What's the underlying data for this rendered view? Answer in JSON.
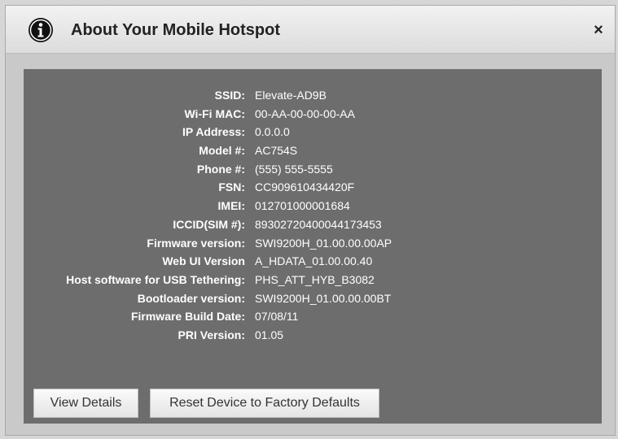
{
  "dialog": {
    "title": "About Your Mobile Hotspot",
    "close_label": "×"
  },
  "info_rows": [
    {
      "label": "SSID:",
      "value": "Elevate-AD9B"
    },
    {
      "label": "Wi-Fi MAC:",
      "value": "00-AA-00-00-00-AA"
    },
    {
      "label": "IP Address:",
      "value": "0.0.0.0"
    },
    {
      "label": "Model #:",
      "value": "AC754S"
    },
    {
      "label": "Phone #:",
      "value": "(555) 555-5555"
    },
    {
      "label": "FSN:",
      "value": "CC909610434420F"
    },
    {
      "label": "IMEI:",
      "value": "012701000001684"
    },
    {
      "label": "ICCID(SIM #):",
      "value": "89302720400044173453"
    },
    {
      "label": "Firmware version:",
      "value": "SWI9200H_01.00.00.00AP"
    },
    {
      "label": "Web UI Version",
      "value": "A_HDATA_01.00.00.40"
    },
    {
      "label": "Host software for USB Tethering:",
      "value": "PHS_ATT_HYB_B3082"
    },
    {
      "label": "Bootloader version:",
      "value": "SWI9200H_01.00.00.00BT"
    },
    {
      "label": "Firmware Build Date:",
      "value": "07/08/11"
    },
    {
      "label": "PRI Version:",
      "value": "01.05"
    }
  ],
  "buttons": {
    "view_details": "View Details",
    "reset": "Reset Device to Factory Defaults"
  },
  "colors": {
    "panel_bg": "#6d6d6d",
    "dialog_bg": "#c9c9c9",
    "text_light": "#ffffff"
  },
  "icons": {
    "title_icon": "info-icon",
    "close_icon": "close-icon"
  }
}
